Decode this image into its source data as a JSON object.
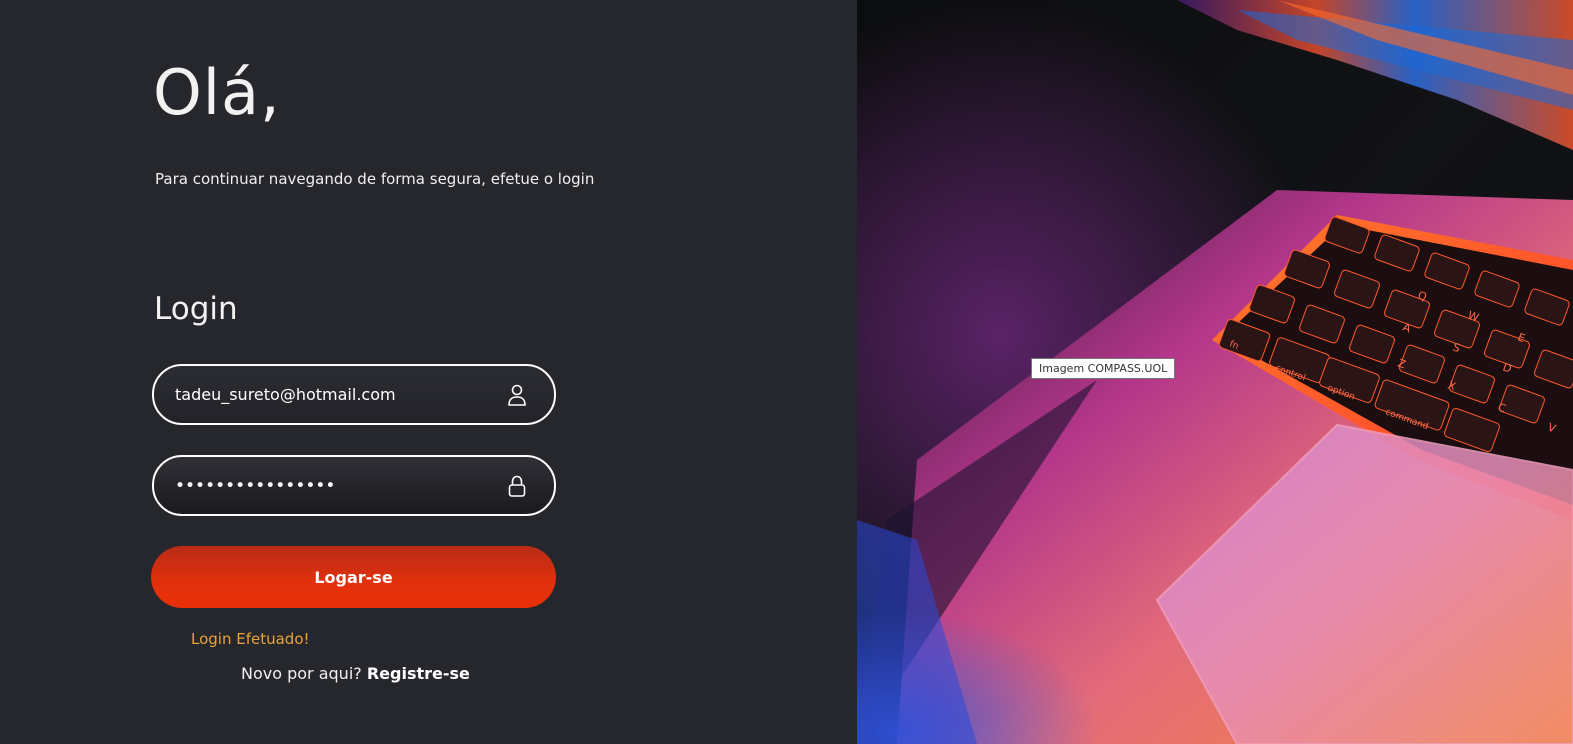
{
  "header": {
    "greeting": "Olá,",
    "subtitle": "Para continuar navegando de forma segura, efetue o login"
  },
  "form": {
    "title": "Login",
    "email": {
      "value": "tadeu_sureto@hotmail.com",
      "icon": "user-icon"
    },
    "password": {
      "value": "passwordpassword",
      "icon": "lock-icon"
    },
    "submit_label": "Logar-se",
    "status_message": "Login Efetuado!",
    "register_prompt": "Novo por aqui?",
    "register_link": "Registre-se"
  },
  "hero_image": {
    "tooltip": "Imagem COMPASS.UOL",
    "keys": [
      "fn",
      "control",
      "option",
      "command",
      "A",
      "S",
      "D",
      "W",
      "E",
      "Q",
      "Z",
      "X",
      "C",
      "V"
    ]
  },
  "colors": {
    "background": "#26272d",
    "button": "#e2300c",
    "status": "#e9a23b",
    "text": "#ffffff"
  }
}
